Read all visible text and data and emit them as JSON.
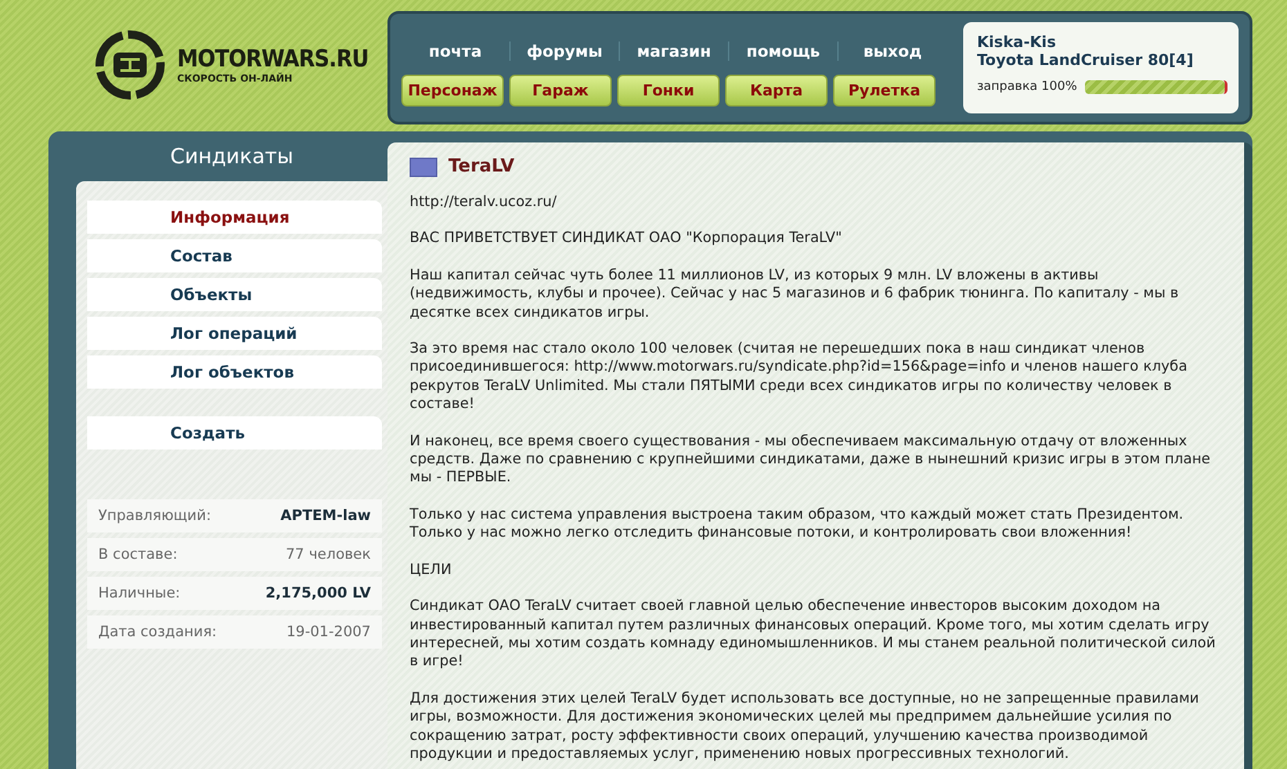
{
  "logo": {
    "name": "MOTORWARS.RU",
    "tagline": "СКОРОСТЬ ОН-ЛАЙН"
  },
  "top_nav": [
    "почта",
    "форумы",
    "магазин",
    "помощь",
    "выход"
  ],
  "game_nav": [
    "Персонаж",
    "Гараж",
    "Гонки",
    "Карта",
    "Рулетка"
  ],
  "player": {
    "name": "Kiska-Kis",
    "car": "Toyota LandCruiser 80[4]",
    "fuel_label": "заправка 100%",
    "level": 1
  },
  "sidebar": {
    "title": "Синдикаты",
    "items": [
      {
        "label": "Информация",
        "selected": true
      },
      {
        "label": "Состав",
        "selected": false
      },
      {
        "label": "Объекты",
        "selected": false
      },
      {
        "label": "Лог операций",
        "selected": false
      },
      {
        "label": "Лог объектов",
        "selected": false
      }
    ],
    "create_button": "Создать",
    "info": [
      {
        "label": "Управляющий:",
        "value": "APTEM-law",
        "emphasis": true
      },
      {
        "label": "В составе:",
        "value": "77 человек",
        "emphasis": false
      },
      {
        "label": "Наличные:",
        "value": "2,175,000 LV",
        "emphasis": true
      },
      {
        "label": "Дата создания:",
        "value": "19-01-2007",
        "emphasis": false
      }
    ]
  },
  "content": {
    "title": "TeraLV",
    "paragraphs": [
      "http://teralv.ucoz.ru/",
      "ВАС ПРИВЕТСТВУЕТ СИНДИКАТ ОАО \"Корпорация TeraLV\"",
      "Наш капитал сейчас чуть более 11 миллионов LV, из которых 9 млн. LV вложены в активы (недвижимость, клубы и прочее). Сейчас у нас 5 магазинов и 6 фабрик тюнинга. По капиталу - мы в десятке всех синдикатов игры.",
      "За это время нас стало около 100 человек (считая не перешедших пока в наш синдикат членов присоединившегося: http://www.motorwars.ru/syndicate.php?id=156&page=info и членов нашего клуба рекрутов TeraLV Unlimited. Мы стали ПЯТЫМИ среди всех синдикатов игры по количеству человек в составе!",
      "И наконец, все время своего существования - мы обеспечиваем максимальную отдачу от вложенных средств. Даже по сравнению с крупнейшими синдикатами, даже в нынешний кризис игры в этом плане мы - ПЕРВЫЕ.",
      "Только у нас система управления выстроена таким образом, что каждый может стать Президентом. Только у нас можно легко отследить финансовые потоки, и контролировать свои вложенния!",
      "ЦЕЛИ",
      "Синдикат ОАО TeraLV считает своей главной целью обеспечение инвесторов высоким доходом на инвестированный капитал путем различных финансовых операций. Кроме того, мы хотим сделать игру интересней, мы хотим создать комнаду единомышленников. И мы станем реальной политической силой в игре!",
      "Для достижения этих целей TeraLV будет использовать все доступные, но не запрещенные правилами игры, возможности. Для достижения экономических целей мы предпримем дальнейшие усилия по сокращению затрат, росту эффективности своих операций, улучшению качества производимой продукции и предоставляемых услуг, применению новых прогрессивных технологий."
    ]
  }
}
